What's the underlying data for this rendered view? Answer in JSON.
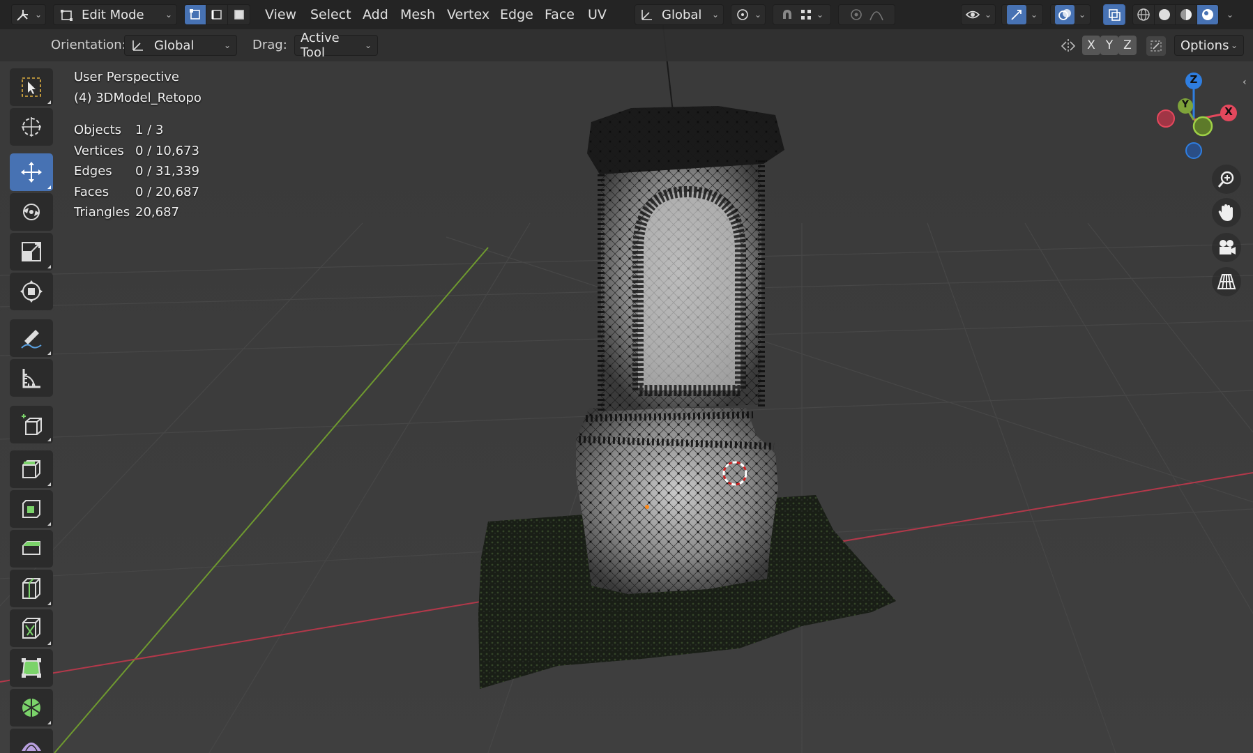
{
  "header": {
    "mode_label": "Edit Mode",
    "menus": [
      "View",
      "Select",
      "Add",
      "Mesh",
      "Vertex",
      "Edge",
      "Face",
      "UV"
    ],
    "transform_orientation": "Global",
    "select_mode_active": "vertex"
  },
  "tool_settings": {
    "orientation_label": "Orientation:",
    "orientation_value": "Global",
    "drag_label": "Drag:",
    "drag_value": "Active Tool",
    "axis_x": "X",
    "axis_y": "Y",
    "axis_z": "Z",
    "options_label": "Options"
  },
  "viewport": {
    "view_name": "User Perspective",
    "object_name": "(4) 3DModel_Retopo",
    "stats": [
      {
        "label": "Objects",
        "value": "1 / 3"
      },
      {
        "label": "Vertices",
        "value": "0 / 10,673"
      },
      {
        "label": "Edges",
        "value": "0 / 31,339"
      },
      {
        "label": "Faces",
        "value": "0 / 20,687"
      },
      {
        "label": "Triangles",
        "value": "20,687"
      }
    ]
  },
  "gizmo": {
    "x": "X",
    "y": "Y",
    "z": "Z"
  },
  "left_tools": [
    {
      "name": "select-box-tool",
      "active": false
    },
    {
      "name": "cursor-tool",
      "active": false
    },
    {
      "name": "move-tool",
      "active": true
    },
    {
      "name": "rotate-tool",
      "active": false
    },
    {
      "name": "scale-tool",
      "active": false
    },
    {
      "name": "transform-tool",
      "active": false
    },
    {
      "name": "annotate-tool",
      "active": false
    },
    {
      "name": "measure-tool",
      "active": false
    },
    {
      "name": "add-cube-tool",
      "active": false
    },
    {
      "name": "extrude-tool",
      "active": false
    },
    {
      "name": "inset-faces-tool",
      "active": false
    },
    {
      "name": "bevel-tool",
      "active": false
    },
    {
      "name": "loop-cut-tool",
      "active": false
    },
    {
      "name": "knife-tool",
      "active": false
    },
    {
      "name": "poly-build-tool",
      "active": false
    },
    {
      "name": "spin-tool",
      "active": false
    },
    {
      "name": "smooth-tool",
      "active": false
    }
  ],
  "colors": {
    "accent": "#4772b3",
    "axis_x": "#e4485d",
    "axis_y": "#7ea33a",
    "axis_z": "#2f7ee0"
  }
}
